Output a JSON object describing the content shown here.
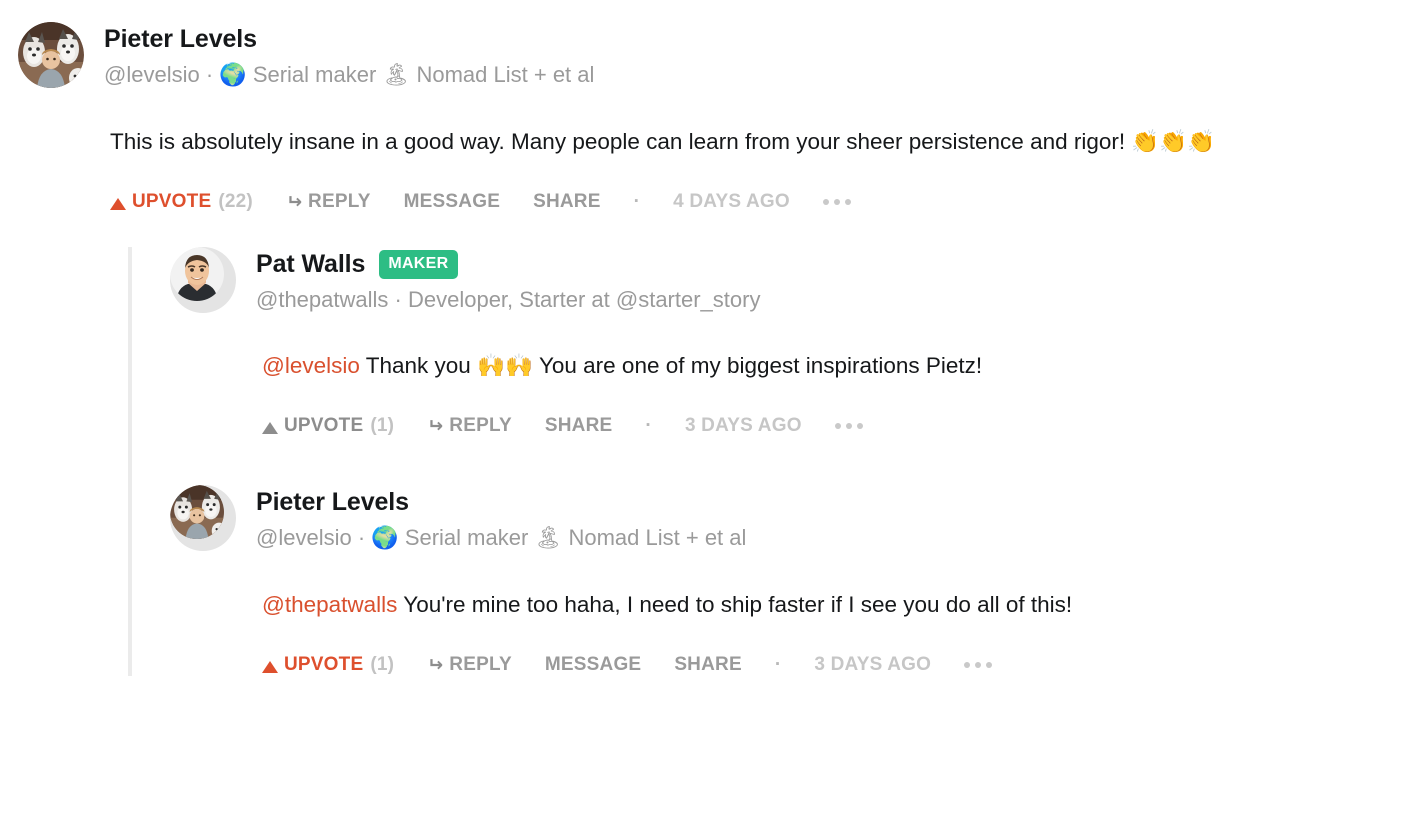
{
  "root_comment": {
    "author": "Pieter Levels",
    "avatar_icon": "avatar-levelsio",
    "byline_handle": "@levelsio",
    "byline_sep": "·",
    "byline_emoji_1": "🌍",
    "byline_role": "Serial maker",
    "byline_emoji_2": "🏝",
    "byline_company": "Nomad List + et al",
    "text_part_1": "This is absolutely insane in a good way. Many people can learn from your sheer persistence and rigor! ",
    "text_emoji": "👏👏👏",
    "actions": {
      "upvote_label": "UPVOTE",
      "upvote_count": "(22)",
      "upvote_state": "voted",
      "reply_label": "REPLY",
      "message_label": "MESSAGE",
      "share_label": "SHARE",
      "separator": "·",
      "timestamp": "4 DAYS AGO",
      "more_label": "more-options"
    }
  },
  "replies": [
    {
      "author": "Pat Walls",
      "avatar_icon": "avatar-thepatwalls",
      "badge": "MAKER",
      "byline_handle": "@thepatwalls",
      "byline_sep": "·",
      "byline_role": "Developer, Starter at @starter_story",
      "mention": "@levelsio",
      "text_part_1": " Thank you ",
      "text_emoji": "🙌🙌",
      "text_part_2": "  You are one of my biggest inspirations Pietz!",
      "actions": {
        "upvote_label": "UPVOTE",
        "upvote_count": "(1)",
        "upvote_state": "plain",
        "reply_label": "REPLY",
        "share_label": "SHARE",
        "separator": "·",
        "timestamp": "3 DAYS AGO",
        "more_label": "more-options"
      }
    },
    {
      "author": "Pieter Levels",
      "avatar_icon": "avatar-levelsio",
      "byline_handle": "@levelsio",
      "byline_sep": "·",
      "byline_emoji_1": "🌍",
      "byline_role": "Serial maker",
      "byline_emoji_2": "🏝",
      "byline_company": "Nomad List + et al",
      "mention": "@thepatwalls",
      "text_part_1": " You're mine too haha, I need to ship faster if I see you do all of this!",
      "actions": {
        "upvote_label": "UPVOTE",
        "upvote_count": "(1)",
        "upvote_state": "voted",
        "reply_label": "REPLY",
        "message_label": "MESSAGE",
        "share_label": "SHARE",
        "separator": "·",
        "timestamp": "3 DAYS AGO",
        "more_label": "more-options"
      }
    }
  ],
  "colors": {
    "upvote_active": "#de4f2d",
    "mention": "#d9502e",
    "maker_badge_bg": "#2dbd84",
    "muted_text": "#9a9a9a",
    "thread_line": "#ebebeb"
  }
}
